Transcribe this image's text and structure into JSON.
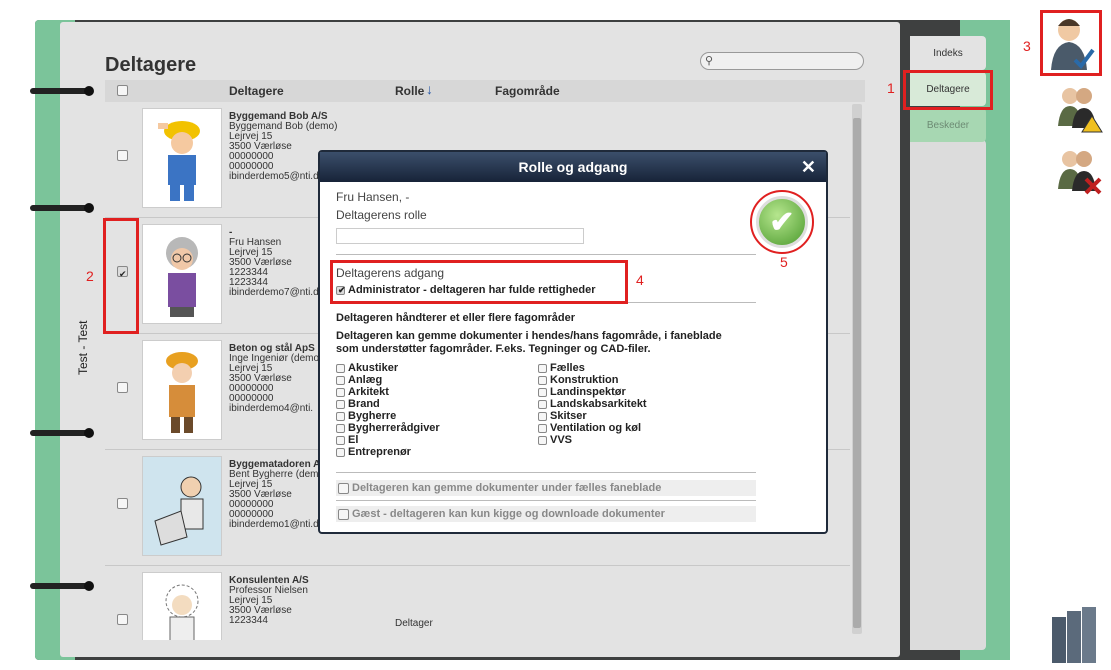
{
  "sidebar_label": "Test - Test",
  "page_title": "Deltagere",
  "search": {
    "placeholder": ""
  },
  "table_header": {
    "participants": "Deltagere",
    "role": "Rolle",
    "role_sort_icon": "↓",
    "area": "Fagområde"
  },
  "participants": [
    {
      "company": "Byggemand Bob A/S",
      "person": "Byggemand Bob (demo)",
      "street": "Lejrvej 15",
      "city": "3500  Værløse",
      "phone1": "00000000",
      "phone2": "00000000",
      "email": "ibinderdemo5@nti.d",
      "checked": false
    },
    {
      "company": "-",
      "person": "Fru Hansen",
      "street": "Lejrvej 15",
      "city": "3500  Værløse",
      "phone1": "1223344",
      "phone2": "1223344",
      "email": "ibinderdemo7@nti.d",
      "checked": true
    },
    {
      "company": "Beton og stål ApS",
      "person": "Inge Ingeniør (demo",
      "street": "Lejrvej 15",
      "city": "3500  Værløse",
      "phone1": "00000000",
      "phone2": "00000000",
      "email": "ibinderdemo4@nti.",
      "checked": false
    },
    {
      "company": "Byggematadoren A",
      "person": "Bent Bygherre (dem",
      "street": "Lejrvej 15",
      "city": "3500  Værløse",
      "phone1": "00000000",
      "phone2": "00000000",
      "email": "ibinderdemo1@nti.dk",
      "checked": false
    },
    {
      "company": "Konsulenten A/S",
      "person": "Professor Nielsen",
      "street": "Lejrvej 15",
      "city": "3500  Værløse",
      "phone1": "1223344",
      "phone2": "",
      "email": "",
      "role": "Deltager",
      "checked": false
    }
  ],
  "tabs": {
    "index": "Indeks",
    "participants": "Deltagere",
    "messages": "Beskeder"
  },
  "markers": {
    "m1": "1",
    "m2": "2",
    "m3": "3",
    "m4": "4",
    "m5": "5"
  },
  "modal": {
    "title": "Rolle og adgang",
    "close": "✕",
    "person_name": "Fru Hansen, -",
    "role_label": "Deltagerens rolle",
    "role_value": "",
    "access_label": "Deltagerens adgang",
    "admin_label": "Administrator - deltageren har fulde rettigheder",
    "areas_heading": "Deltageren håndterer et eller flere fagområder",
    "areas_desc_1": "Deltageren kan gemme dokumenter i hendes/hans fagområde, i faneblade",
    "areas_desc_2": "som understøtter fagområder. F.eks. Tegninger og CAD-filer.",
    "areas_left": [
      "Akustiker",
      "Anlæg",
      "Arkitekt",
      "Brand",
      "Bygherre",
      "Bygherrerådgiver",
      "El",
      "Entreprenør"
    ],
    "areas_right": [
      "Fælles",
      "Konstruktion",
      "Landinspektør",
      "Landskabsarkitekt",
      "Skitser",
      "Ventilation og køl",
      "VVS"
    ],
    "common_tabs": "Deltageren kan gemme dokumenter under fælles faneblade",
    "guest": "Gæst - deltageren kan kun kigge og downloade dokumenter"
  },
  "colors": {
    "accent_red": "#e02020",
    "header_blue": "#1f2a3a",
    "binder_green": "#7bc49a"
  }
}
